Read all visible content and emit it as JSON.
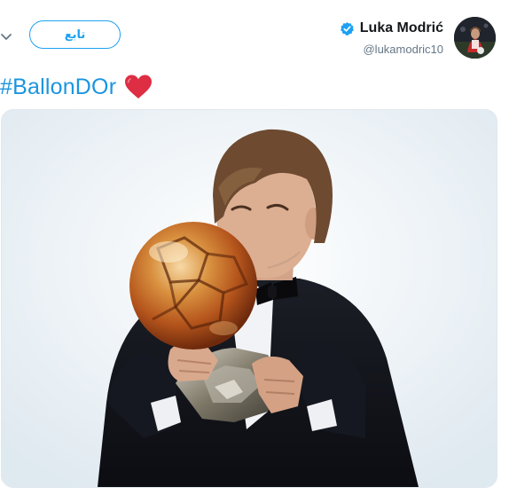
{
  "user": {
    "display_name": "Luka Modrić",
    "handle": "@lukamodric10",
    "verified": true,
    "avatar_icon": "profile-photo"
  },
  "actions": {
    "follow_label": "تابع",
    "menu_icon": "chevron-down-icon"
  },
  "tweet": {
    "hashtag": "#BallonDOr",
    "emoji_icon": "red-heart-icon"
  },
  "media": {
    "icon": "photo-ballon-dor-kiss"
  },
  "colors": {
    "accent": "#1da1f2",
    "link": "#1b95e0",
    "name": "#14171a",
    "handle": "#657786",
    "heart": "#e0245e",
    "border": "#e1e8ed"
  }
}
